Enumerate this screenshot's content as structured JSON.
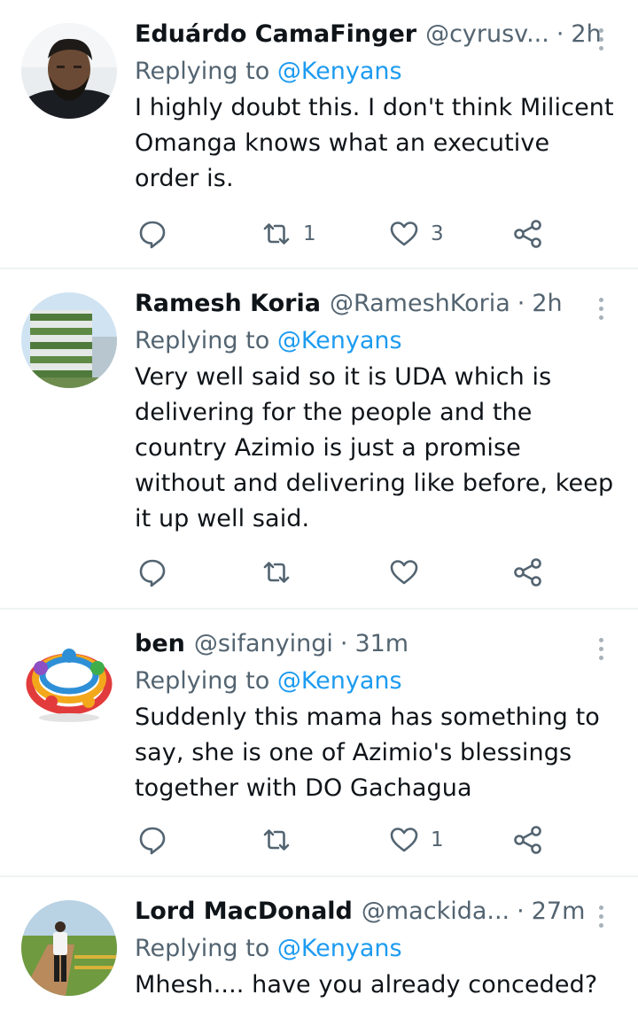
{
  "reply_prefix": "Replying to",
  "tweets": [
    {
      "name": "Eduárdo CamaFinger",
      "handle": "@cyrusv...",
      "separator": "·",
      "time": "2h",
      "replying_to": "@Kenyans",
      "text": "I highly doubt this. I don't think Milicent Omanga knows what an executive order is.",
      "replies": "",
      "retweets": "1",
      "likes": "3",
      "avatar": "man-with-beard-avatar"
    },
    {
      "name": "Ramesh Koria",
      "handle": "@RameshKoria",
      "separator": "·",
      "time": "2h",
      "replying_to": "@Kenyans",
      "text": "Very well said so it is UDA which is delivering for the people and the country Azimio is just a promise without and delivering like before, keep it up well said.",
      "replies": "",
      "retweets": "",
      "likes": "",
      "avatar": "green-building-avatar"
    },
    {
      "name": "ben",
      "handle": "@sifanyingi",
      "separator": "·",
      "time": "31m",
      "replying_to": "@Kenyans",
      "text": "Suddenly this mama has something to say, she is one of Azimio's blessings together with DO Gachagua",
      "replies": "",
      "retweets": "",
      "likes": "1",
      "avatar": "colorful-people-circle-avatar"
    },
    {
      "name": "Lord MacDonald",
      "handle": "@mackida...",
      "separator": "·",
      "time": "27m",
      "replying_to": "@Kenyans",
      "text": "Mhesh.... have you already conceded?",
      "replies": "",
      "retweets": "",
      "likes": "",
      "avatar": "man-walking-outdoors-avatar"
    }
  ],
  "colors": {
    "link": "#1d9bf0",
    "secondary_text": "#536471",
    "icon": "#536471",
    "divider": "#eff3f4"
  }
}
